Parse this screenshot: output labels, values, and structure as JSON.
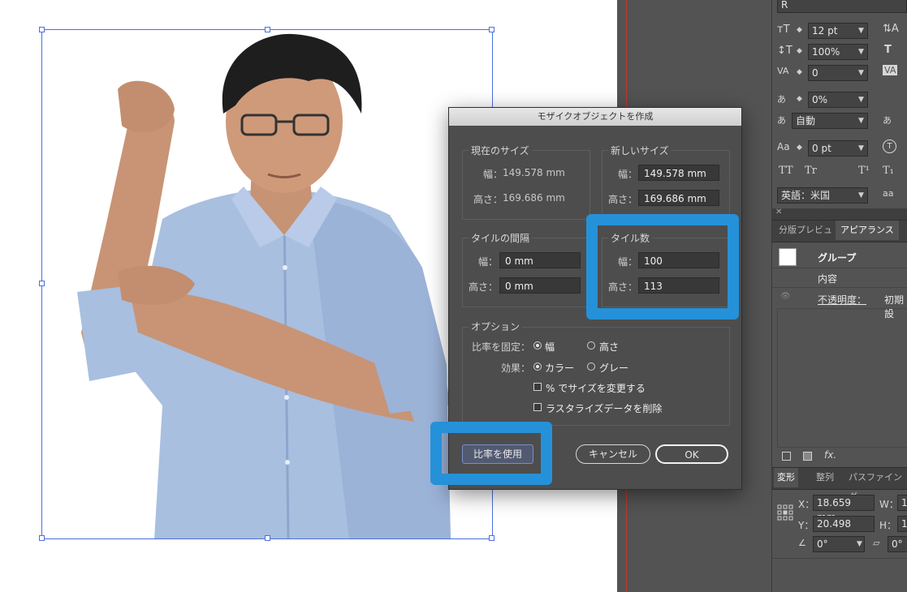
{
  "dialog": {
    "title": "モザイクオブジェクトを作成",
    "current_size": {
      "label": "現在のサイズ",
      "width_label": "幅：",
      "width_value": "149.578 mm",
      "height_label": "高さ：",
      "height_value": "169.686 mm"
    },
    "new_size": {
      "label": "新しいサイズ",
      "width_label": "幅：",
      "width_value": "149.578 mm",
      "height_label": "高さ：",
      "height_value": "169.686 mm"
    },
    "tile_spacing": {
      "label": "タイルの間隔",
      "width_label": "幅：",
      "width_value": "0 mm",
      "height_label": "高さ：",
      "height_value": "0 mm"
    },
    "tile_count": {
      "label": "タイル数",
      "width_label": "幅：",
      "width_value": "100",
      "height_label": "高さ：",
      "height_value": "113"
    },
    "options": {
      "label": "オプション",
      "constrain_label": "比率を固定：",
      "constrain_width": "幅",
      "constrain_height": "高さ",
      "result_label": "効果：",
      "result_color": "カラー",
      "result_gray": "グレー",
      "resize_percent": "% でサイズを変更する",
      "delete_raster": "ラスタライズデータを削除"
    },
    "use_ratio_button": "比率を使用",
    "cancel_button": "キャンセル",
    "ok_button": "OK"
  },
  "character_panel": {
    "font_style": "R",
    "font_size": "12 pt",
    "leading_icon": "A",
    "vertical_scale": "100%",
    "kerning": "0",
    "tsume": "0%",
    "aki": "自動",
    "baseline_shift": "0 pt",
    "rotation_icon": "T",
    "tt1": "TT",
    "tt2": "Tr",
    "tsup": "T¹",
    "tsub": "T₁",
    "language": "英語：米国",
    "aa": "aa"
  },
  "appearance_panel": {
    "tab_preview": "分版プレビュ",
    "tab_appearance": "アピアランス",
    "group_label": "グループ",
    "contents_label": "内容",
    "opacity_label": "不透明度：",
    "opacity_value": "初期設",
    "fx_label": "fx."
  },
  "transform_panel": {
    "tab_transform": "変形",
    "tab_align": "整列",
    "tab_pathfinder": "パスファインダ",
    "x_label": "X：",
    "x_value": "18.659 mm",
    "y_label": "Y：",
    "y_value": "20.498 mm",
    "w_label": "W：",
    "w_value": "1",
    "h_label": "H：",
    "h_value": "1",
    "angle_value": "0°",
    "shear_value": "0°"
  },
  "colors": {
    "highlight": "#2591d9",
    "selection": "#4a6fdc",
    "dialog_bg": "#4d4d4d",
    "panel_bg": "#535353"
  }
}
